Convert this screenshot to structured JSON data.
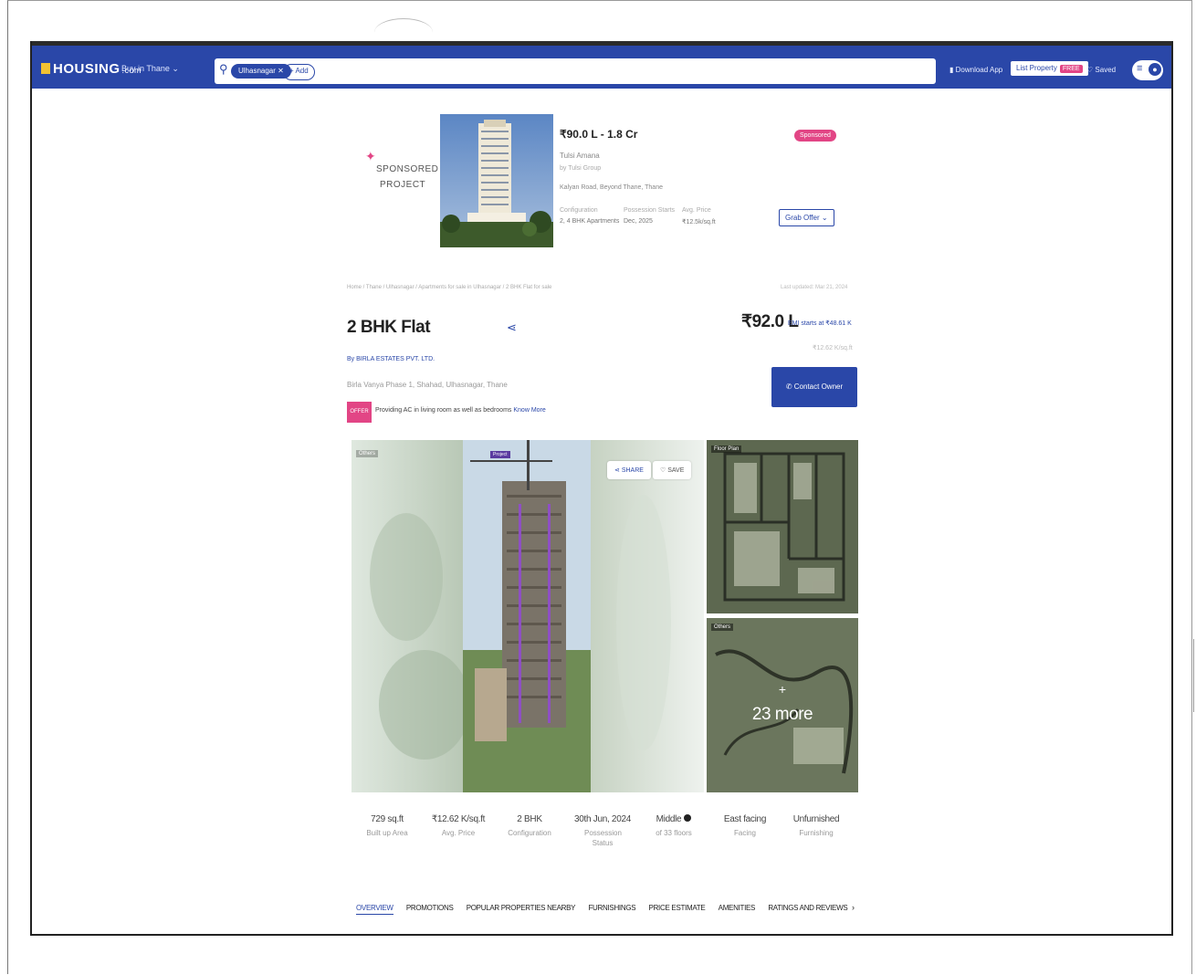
{
  "header": {
    "logo": "HOUSING",
    "logo_suffix": ".com",
    "city_label": "Buy in Thane ⌄",
    "search_chip": "Ulhasnagar ✕",
    "search_more": "+ Add",
    "download_app": "Download App",
    "list_property": "List Property",
    "list_property_badge": "FREE",
    "saved": "Saved",
    "menu_icon_glyph": "≡",
    "user_icon_glyph": "👤"
  },
  "sponsored": {
    "label_line1": "SPONSORED",
    "label_line2": "PROJECT",
    "price_range": "₹90.0 L - 1.8 Cr",
    "project_name": "Tulsi Amana",
    "project_sub": "by Tulsi Group",
    "location": "Kalyan Road, Beyond Thane, Thane",
    "stats": [
      {
        "key": "Configuration",
        "value": "2, 4 BHK Apartments"
      },
      {
        "key": "Possession Starts",
        "value": "Dec, 2025"
      },
      {
        "key": "Avg. Price",
        "value": "₹12.5k/sq.ft"
      }
    ],
    "badge": "Sponsored",
    "offer_button": "Grab Offer ⌄"
  },
  "listing": {
    "breadcrumb": "Home / Thane / Ulhasnagar / Apartments for sale in Ulhasnagar / 2 BHK Flat for sale",
    "last_updated": "Last updated: Mar 21, 2024",
    "title": "2 BHK Flat",
    "price": "₹92.0 L",
    "emi": "EMI starts at ₹48.61 K",
    "price_sub": "₹12.62 K/sq.ft",
    "developer": "By BIRLA ESTATES PVT. LTD.",
    "address": "Birla Vanya Phase 1, Shahad, Ulhasnagar, Thane",
    "contact_button": "Contact Owner",
    "offer_tag": "OFFER",
    "offer_text": "Providing AC in living room as well as bedrooms",
    "offer_more": "Know More"
  },
  "gallery": {
    "main_count": "Others",
    "main_tag": "Project",
    "share": "SHARE",
    "save": "SAVE",
    "side1_tag": "Floor Plan",
    "side2_tag": "Others",
    "more_plus": "+",
    "more_count": "23 more"
  },
  "facts": [
    {
      "value": "729 sq.ft",
      "key": "Built up Area"
    },
    {
      "value": "₹12.62 K/sq.ft",
      "key": "Avg. Price"
    },
    {
      "value": "2 BHK",
      "key": "Configuration"
    },
    {
      "value": "30th Jun, 2024",
      "key": "Possession Status"
    },
    {
      "value": "Middle",
      "key": "of 33 floors"
    },
    {
      "value": "East facing",
      "key": "Facing"
    },
    {
      "value": "Unfurnished",
      "key": "Furnishing"
    }
  ],
  "tabs": [
    "OVERVIEW",
    "PROMOTIONS",
    "POPULAR PROPERTIES NEARBY",
    "FURNISHINGS",
    "PRICE ESTIMATE",
    "AMENITIES",
    "RATINGS AND REVIEWS"
  ],
  "tab_next": "›",
  "colors": {
    "brand_blue": "#2a47a8",
    "accent_pink": "#e24585",
    "logo_yellow": "#f3c233"
  }
}
